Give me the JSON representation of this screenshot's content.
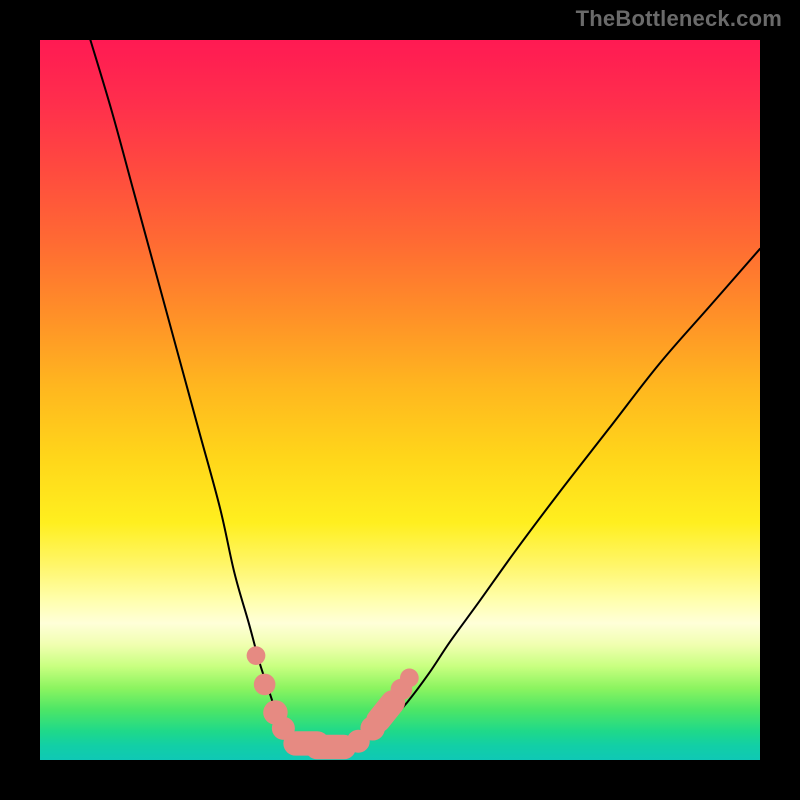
{
  "watermark": "TheBottleneck.com",
  "chart_data": {
    "type": "line",
    "title": "",
    "xlabel": "",
    "ylabel": "",
    "xlim": [
      0,
      100
    ],
    "ylim": [
      0,
      100
    ],
    "grid": false,
    "legend": false,
    "series": [
      {
        "name": "left-curve",
        "x": [
          7,
          10,
          13,
          16,
          19,
          22,
          25,
          27,
          29,
          30.5,
          32,
          33,
          34,
          35.5,
          37
        ],
        "values": [
          100,
          90,
          79,
          68,
          57,
          46,
          35,
          26,
          19,
          13.5,
          9,
          6,
          4,
          2.7,
          2.1
        ]
      },
      {
        "name": "right-curve",
        "x": [
          43,
          44.5,
          46,
          47.5,
          49,
          51,
          54,
          57,
          61,
          66,
          72,
          79,
          86,
          93,
          100
        ],
        "values": [
          2.1,
          2.5,
          3.3,
          4.4,
          5.8,
          8.0,
          12,
          16.5,
          22,
          29,
          37,
          46,
          55,
          63,
          71
        ]
      },
      {
        "name": "trough-floor",
        "x": [
          35.5,
          37,
          38.5,
          40,
          41.5,
          43,
          44.5
        ],
        "values": [
          2.7,
          2.1,
          1.8,
          1.7,
          1.8,
          2.1,
          2.5
        ]
      }
    ],
    "markers": [
      {
        "name": "salmon-dot",
        "x": 30.0,
        "y": 14.5,
        "r": 1.3
      },
      {
        "name": "salmon-dot",
        "x": 31.2,
        "y": 10.5,
        "r": 1.5
      },
      {
        "name": "salmon-dot",
        "x": 32.7,
        "y": 6.6,
        "r": 1.7
      },
      {
        "name": "salmon-dot",
        "x": 33.8,
        "y": 4.4,
        "r": 1.6
      },
      {
        "name": "salmon-pill-h",
        "x1": 35.5,
        "x2": 38.5,
        "y": 2.3,
        "r": 1.7
      },
      {
        "name": "salmon-pill-h",
        "x1": 38.5,
        "x2": 42.2,
        "y": 1.8,
        "r": 1.7
      },
      {
        "name": "salmon-dot",
        "x": 44.2,
        "y": 2.6,
        "r": 1.6
      },
      {
        "name": "salmon-dot",
        "x": 46.2,
        "y": 4.4,
        "r": 1.7
      },
      {
        "name": "salmon-pill-d",
        "x1": 47.0,
        "y1": 5.5,
        "x2": 49.0,
        "y2": 8.0,
        "r": 1.7
      },
      {
        "name": "salmon-dot",
        "x": 50.2,
        "y": 9.8,
        "r": 1.5
      },
      {
        "name": "salmon-dot",
        "x": 51.3,
        "y": 11.4,
        "r": 1.3
      }
    ],
    "colors": {
      "curve": "#000000",
      "marker_fill": "#e68a82",
      "marker_stroke": "#cc6a63"
    }
  }
}
